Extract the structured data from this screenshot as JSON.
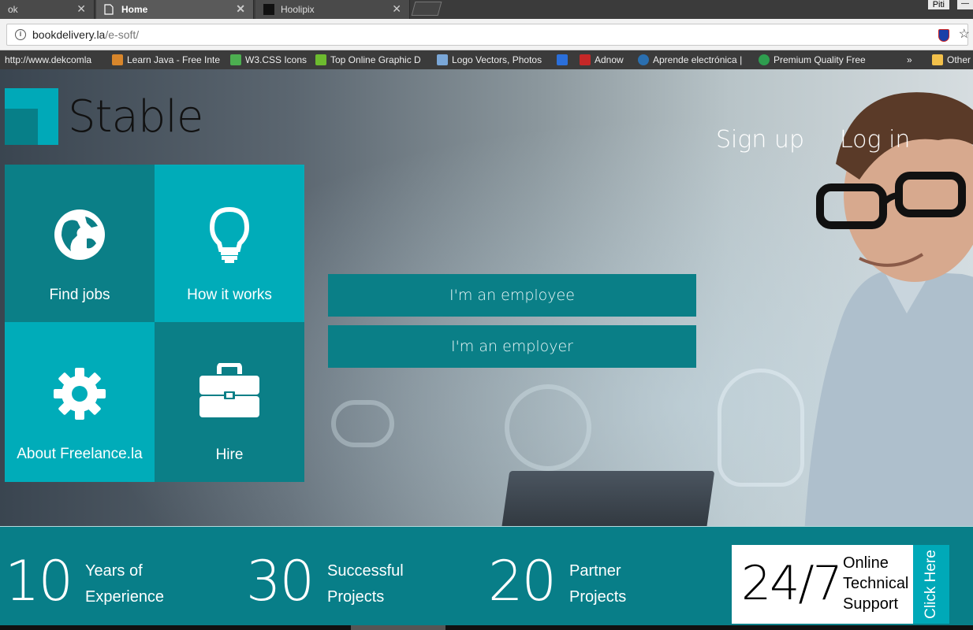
{
  "browser": {
    "tabs": [
      {
        "title": "ok"
      },
      {
        "title": "Home"
      },
      {
        "title": "Hoolipix"
      }
    ],
    "user_badge": "Piti",
    "url_host": "bookdelivery.la",
    "url_path": "/e-soft/",
    "bookmarks": [
      {
        "label": "http://www.dekcomla"
      },
      {
        "label": "Learn Java - Free Inte"
      },
      {
        "label": "W3.CSS Icons"
      },
      {
        "label": "Top Online Graphic D"
      },
      {
        "label": "Logo Vectors, Photos"
      },
      {
        "label": ""
      },
      {
        "label": "Adnow"
      },
      {
        "label": "Aprende electrónica |"
      },
      {
        "label": "Premium Quality Free"
      },
      {
        "label": "»"
      },
      {
        "label": "Other"
      }
    ]
  },
  "site": {
    "logo_text": "Stable",
    "auth": {
      "signup": "Sign up",
      "login": "Log in"
    },
    "tiles": [
      {
        "label": "Find jobs",
        "icon": "globe-icon"
      },
      {
        "label": "How it works",
        "icon": "lightbulb-icon"
      },
      {
        "label": "About Freelance.la",
        "icon": "gear-icon"
      },
      {
        "label": "Hire",
        "icon": "briefcase-icon"
      }
    ],
    "cta": {
      "employee": "I'm an employee",
      "employer": "I'm an employer"
    },
    "stats": [
      {
        "number": "10",
        "line1": "Years of",
        "line2": "Experience"
      },
      {
        "number": "30",
        "line1": "Successful",
        "line2": "Projects"
      },
      {
        "number": "20",
        "line1": "Partner",
        "line2": "Projects"
      }
    ],
    "support": {
      "big": "24/7",
      "line1": "Online",
      "line2": "Technical",
      "line3": "Support",
      "button": "Click Here"
    }
  },
  "colors": {
    "teal_dark": "#0b7f87",
    "teal_light": "#00acb9",
    "stats_bg": "#087e88"
  }
}
